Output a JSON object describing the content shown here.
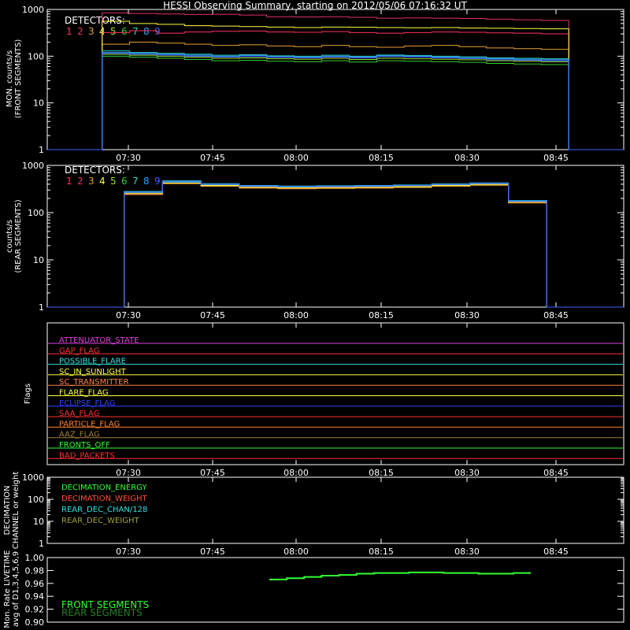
{
  "title": "HESSI Observing Summary, starting on 2012/05/06 07:16:32 UT",
  "chart_data": [
    {
      "type": "line",
      "id": "front",
      "ylabel": [
        "MON. counts/s",
        "(FRONT SEGMENTS)"
      ],
      "yscale": "log",
      "ylim": [
        1,
        1000
      ],
      "yticks": [
        "1",
        "10",
        "100",
        "1000"
      ],
      "xlabel": "",
      "xticks": [
        "07:30",
        "07:45",
        "08:00",
        "08:15",
        "08:30",
        "08:45"
      ],
      "legend_title": "DETECTORS:",
      "legend_labels": [
        "1",
        "2",
        "3",
        "4",
        "5",
        "6",
        "7",
        "8",
        "9"
      ],
      "detector_colors": [
        "#ff3060",
        "#e0306e",
        "#e8a030",
        "#ffff40",
        "#a0e030",
        "#30d030",
        "#30d0c0",
        "#30a0ff",
        "#4060ff"
      ],
      "series": [
        {
          "name": "1",
          "values": [
            0,
            0,
            320,
            350,
            310,
            330,
            340,
            345,
            330,
            325,
            335,
            320,
            310,
            320,
            330,
            325,
            315,
            310,
            300,
            0,
            0
          ]
        },
        {
          "name": "2",
          "values": [
            0,
            0,
            850,
            820,
            800,
            780,
            790,
            760,
            700,
            690,
            700,
            680,
            650,
            660,
            650,
            640,
            620,
            600,
            580,
            0,
            0
          ]
        },
        {
          "name": "3",
          "values": [
            0,
            0,
            180,
            200,
            190,
            180,
            170,
            175,
            165,
            160,
            170,
            160,
            155,
            165,
            170,
            160,
            150,
            145,
            140,
            0,
            0
          ]
        },
        {
          "name": "4",
          "values": [
            0,
            0,
            560,
            500,
            480,
            450,
            440,
            430,
            420,
            410,
            420,
            415,
            410,
            405,
            410,
            400,
            395,
            390,
            385,
            0,
            0
          ]
        },
        {
          "name": "5",
          "values": [
            0,
            0,
            110,
            105,
            100,
            95,
            90,
            92,
            88,
            86,
            90,
            85,
            90,
            88,
            86,
            84,
            80,
            78,
            76,
            0,
            0
          ]
        },
        {
          "name": "6",
          "values": [
            0,
            0,
            100,
            95,
            90,
            85,
            80,
            82,
            78,
            76,
            80,
            75,
            80,
            78,
            76,
            74,
            70,
            68,
            66,
            0,
            0
          ]
        },
        {
          "name": "7",
          "values": [
            0,
            0,
            130,
            120,
            115,
            110,
            105,
            108,
            102,
            100,
            105,
            100,
            106,
            104,
            100,
            97,
            92,
            90,
            88,
            0,
            0
          ]
        },
        {
          "name": "8",
          "values": [
            0,
            0,
            120,
            115,
            110,
            105,
            100,
            103,
            98,
            95,
            100,
            96,
            102,
            100,
            96,
            93,
            88,
            86,
            84,
            0,
            0
          ]
        },
        {
          "name": "9",
          "values": [
            0,
            0,
            115,
            110,
            106,
            100,
            96,
            98,
            94,
            92,
            96,
            92,
            98,
            96,
            92,
            89,
            84,
            82,
            80,
            0,
            0
          ]
        }
      ]
    },
    {
      "type": "line",
      "id": "rear",
      "ylabel": [
        "counts/s",
        "(REAR SEGMENTS)"
      ],
      "yscale": "log",
      "ylim": [
        1,
        1000
      ],
      "yticks": [
        "1",
        "10",
        "100",
        "1000"
      ],
      "xlabel": "",
      "xticks": [
        "07:30",
        "07:45",
        "08:00",
        "08:15",
        "08:30",
        "08:45"
      ],
      "legend_title": "DETECTORS:",
      "legend_labels": [
        "1",
        "2",
        "3",
        "4",
        "5",
        "6",
        "7",
        "8",
        "9"
      ],
      "series": [
        {
          "name": "1",
          "values": [
            0,
            0,
            260,
            430,
            380,
            350,
            340,
            345,
            350,
            360,
            380,
            400,
            170,
            0,
            0
          ]
        },
        {
          "name": "2",
          "values": [
            0,
            0,
            250,
            420,
            370,
            340,
            330,
            335,
            340,
            350,
            370,
            390,
            165,
            0,
            0
          ]
        },
        {
          "name": "3",
          "values": [
            0,
            0,
            240,
            410,
            360,
            330,
            320,
            325,
            330,
            340,
            360,
            380,
            160,
            0,
            0
          ]
        },
        {
          "name": "4",
          "values": [
            0,
            0,
            255,
            425,
            375,
            345,
            335,
            340,
            345,
            355,
            375,
            395,
            168,
            0,
            0
          ]
        },
        {
          "name": "5",
          "values": [
            0,
            0,
            270,
            450,
            400,
            365,
            355,
            360,
            365,
            375,
            395,
            415,
            175,
            0,
            0
          ]
        },
        {
          "name": "6",
          "values": [
            0,
            0,
            265,
            440,
            390,
            360,
            350,
            355,
            360,
            370,
            390,
            410,
            172,
            0,
            0
          ]
        },
        {
          "name": "7",
          "values": [
            0,
            0,
            280,
            470,
            410,
            375,
            365,
            370,
            375,
            385,
            405,
            425,
            180,
            0,
            0
          ]
        },
        {
          "name": "8",
          "values": [
            0,
            0,
            275,
            460,
            405,
            370,
            360,
            365,
            370,
            380,
            400,
            420,
            178,
            0,
            0
          ]
        },
        {
          "name": "9",
          "values": [
            0,
            0,
            268,
            445,
            395,
            362,
            352,
            357,
            362,
            372,
            392,
            412,
            174,
            0,
            0
          ]
        }
      ]
    },
    {
      "type": "line",
      "id": "flags",
      "ylabel": [
        "Flags"
      ],
      "xticks": [
        "07:30",
        "07:45",
        "08:00",
        "08:15",
        "08:30",
        "08:45"
      ],
      "series": [
        {
          "name": "ATTENUATOR_STATE",
          "color": "#e040e0"
        },
        {
          "name": "GAP_FLAG",
          "color": "#ff3030"
        },
        {
          "name": "POSSIBLE_FLARE",
          "color": "#30e0e0"
        },
        {
          "name": "SC_IN_SUNLIGHT",
          "color": "#ffff40"
        },
        {
          "name": "SC_TRANSMITTER",
          "color": "#ff8040"
        },
        {
          "name": "FLARE_FLAG",
          "color": "#ffff40"
        },
        {
          "name": "ECLIPSE_FLAG",
          "color": "#3040ff"
        },
        {
          "name": "SAA_FLAG",
          "color": "#ff3030"
        },
        {
          "name": "PARTICLE_FLAG",
          "color": "#ff8030"
        },
        {
          "name": "AAZ_FLAG",
          "color": "#a08030"
        },
        {
          "name": "FRONTS_OFF",
          "color": "#30ff30"
        },
        {
          "name": "BAD_PACKETS",
          "color": "#ff3030"
        }
      ]
    },
    {
      "type": "line",
      "id": "decimation",
      "ylabel": [
        "DECIMATION",
        "CHANNEL or weight"
      ],
      "yscale": "log",
      "ylim": [
        1,
        1000
      ],
      "yticks": [
        "1",
        "10",
        "100",
        "1000"
      ],
      "xticks": [
        "07:30",
        "07:45",
        "08:00",
        "08:15",
        "08:30",
        "08:45"
      ],
      "series": [
        {
          "name": "DECIMATION_ENERGY",
          "color": "#30ff30"
        },
        {
          "name": "DECIMATION_WEIGHT",
          "color": "#ff5030"
        },
        {
          "name": "REAR_DEC_CHAN/128",
          "color": "#30e0e0"
        },
        {
          "name": "REAR_DEC_WEIGHT",
          "color": "#a0a040"
        }
      ]
    },
    {
      "type": "line",
      "id": "livetime",
      "ylabel": [
        "Mon. Rate LIVETIME",
        "avg of D1,3,4,5,6,9"
      ],
      "ylim": [
        0.9,
        1.0
      ],
      "yticks": [
        "0.90",
        "0.92",
        "0.94",
        "0.96",
        "0.98",
        "1.00"
      ],
      "series": [
        {
          "name": "FRONT SEGMENTS",
          "color": "#30ff30",
          "values": [
            0.966,
            0.968,
            0.97,
            0.972,
            0.973,
            0.975,
            0.976,
            0.976,
            0.977,
            0.977,
            0.976,
            0.976,
            0.975,
            0.975,
            0.976
          ]
        },
        {
          "name": "REAR SEGMENTS",
          "color": "#208020"
        }
      ]
    }
  ],
  "ui": {
    "legend_title_text": "DETECTORS:"
  }
}
